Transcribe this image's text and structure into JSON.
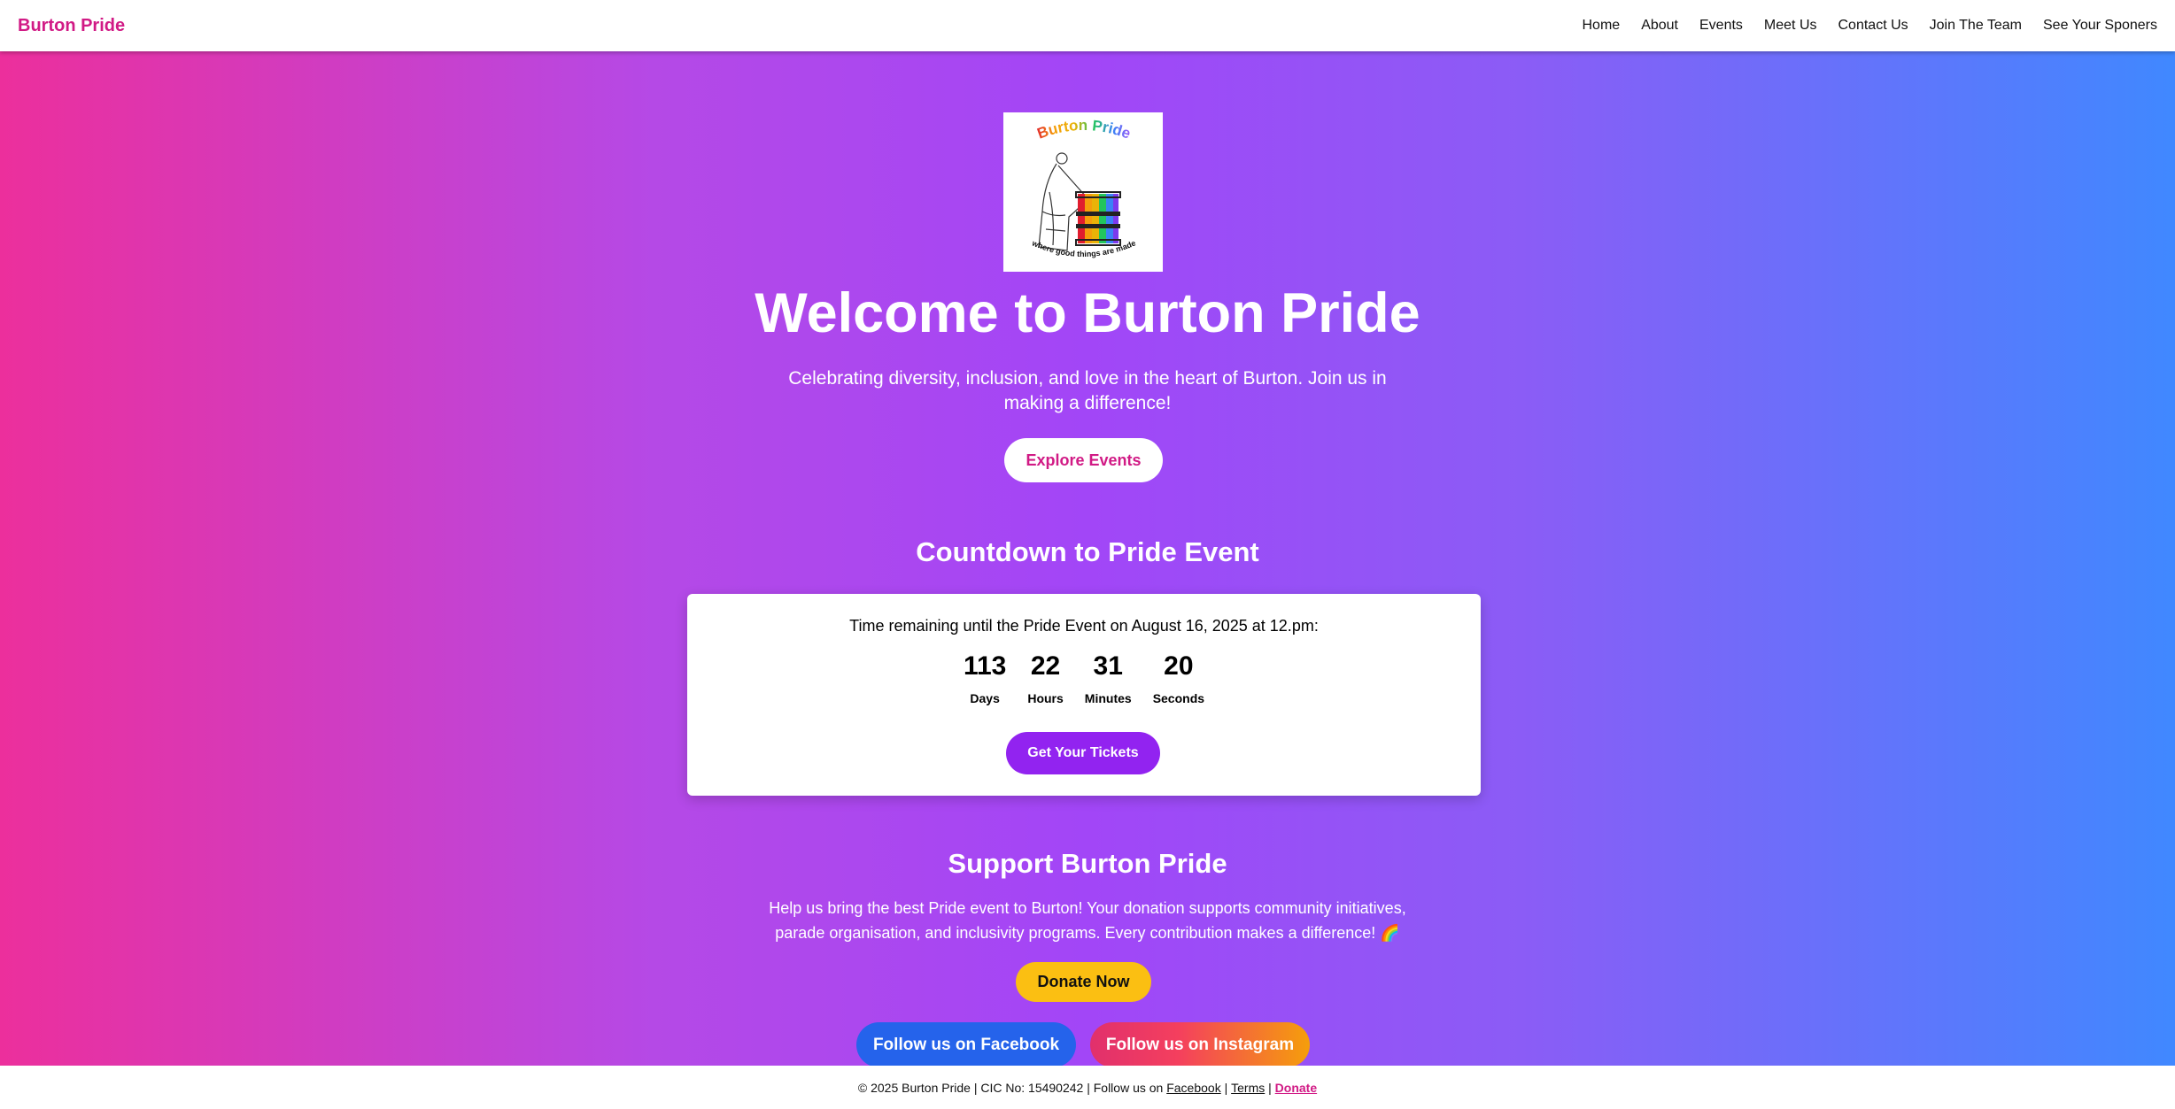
{
  "nav": {
    "brand": "Burton Pride",
    "links": [
      "Home",
      "About",
      "Events",
      "Meet Us",
      "Contact Us",
      "Join The Team",
      "See Your Sponers"
    ]
  },
  "hero": {
    "logo": {
      "title": "Burton Pride",
      "tagline": "where good things are made"
    },
    "title": "Welcome to Burton Pride",
    "subtitle": "Celebrating diversity, inclusion, and love in the heart of Burton. Join us in making a difference!",
    "cta_label": "Explore Events"
  },
  "countdown": {
    "title": "Countdown to Pride Event",
    "text": "Time remaining until the Pride Event on August 16, 2025 at 12.pm:",
    "units": [
      {
        "value": "113",
        "label": "Days"
      },
      {
        "value": "22",
        "label": "Hours"
      },
      {
        "value": "31",
        "label": "Minutes"
      },
      {
        "value": "20",
        "label": "Seconds"
      }
    ],
    "button_label": "Get Your Tickets"
  },
  "support": {
    "title": "Support Burton Pride",
    "text": "Help us bring the best Pride event to Burton! Your donation supports community initiatives, parade organisation, and inclusivity programs. Every contribution makes a difference! 🌈",
    "donate_label": "Donate Now",
    "facebook_label": "Follow us on Facebook",
    "instagram_label": "Follow us on Instagram"
  },
  "footer": {
    "prefix": "© 2025 Burton Pride | CIC No: 15490242 | Follow us on ",
    "facebook": "Facebook",
    "sep1": " | ",
    "terms": "Terms",
    "sep2": " | ",
    "donate": "Donate"
  },
  "colors": {
    "brand": "#d11a85",
    "ticket_button": "#9223f0",
    "donate_button": "#fbbf12",
    "facebook_button": "#2563eb"
  }
}
